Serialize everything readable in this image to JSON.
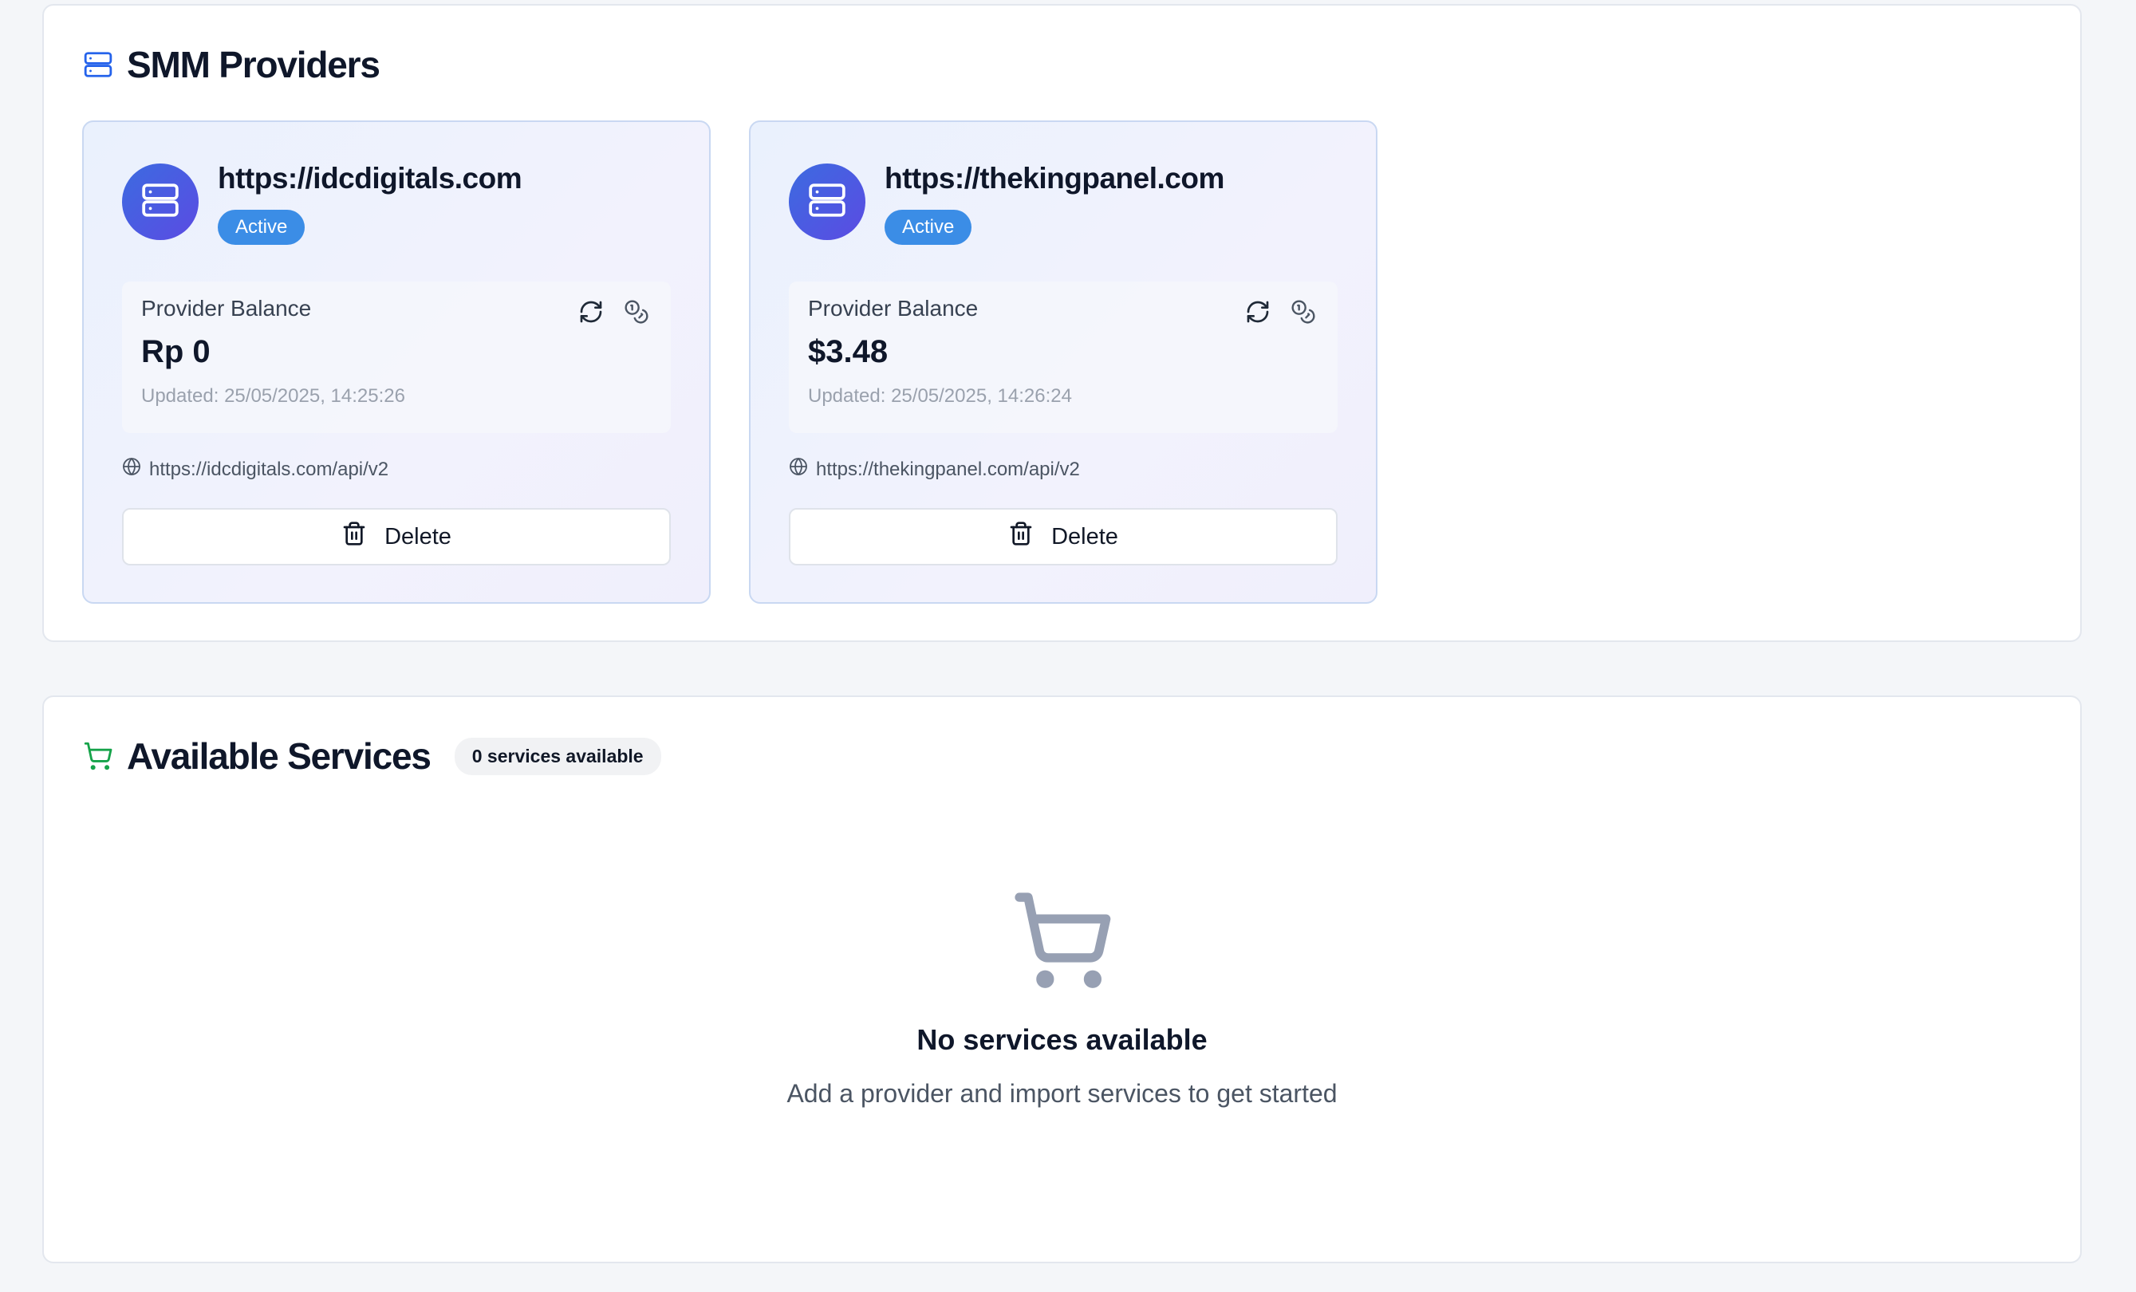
{
  "providers_section": {
    "title": "SMM Providers",
    "icon": "server-icon",
    "cards": [
      {
        "name": "https://idcdigitals.com",
        "status": "Active",
        "balance_label": "Provider Balance",
        "balance_value": "Rp 0",
        "updated": "Updated: 25/05/2025, 14:25:26",
        "api_url": "https://idcdigitals.com/api/v2",
        "delete_label": "Delete"
      },
      {
        "name": "https://thekingpanel.com",
        "status": "Active",
        "balance_label": "Provider Balance",
        "balance_value": "$3.48",
        "updated": "Updated: 25/05/2025, 14:26:24",
        "api_url": "https://thekingpanel.com/api/v2",
        "delete_label": "Delete"
      }
    ]
  },
  "services_section": {
    "title": "Available Services",
    "icon": "shopping-cart-icon",
    "count_badge": "0 services available",
    "empty_title": "No services available",
    "empty_subtitle": "Add a provider and import services to get started"
  },
  "colors": {
    "accent_blue": "#3b8de6",
    "avatar_gradient_start": "#3c6be0",
    "avatar_gradient_end": "#5b4be3",
    "cart_green": "#16a34a",
    "empty_icon_gray": "#97a0b3"
  }
}
